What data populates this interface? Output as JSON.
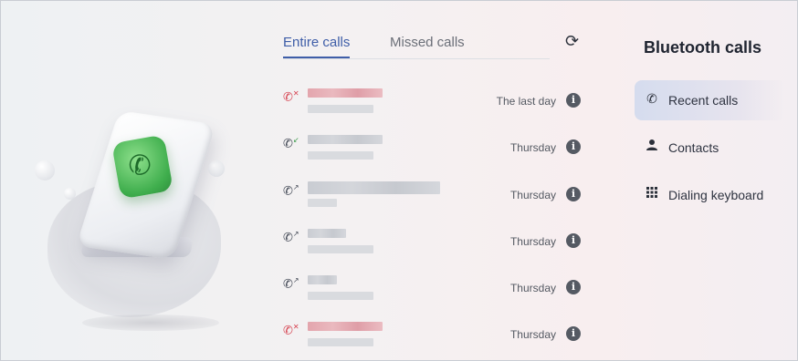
{
  "tabs": {
    "entire": "Entire calls",
    "missed": "Missed calls"
  },
  "refresh_icon": "refresh-icon",
  "calls": [
    {
      "status": "missed",
      "time": "The last day"
    },
    {
      "status": "outgoing",
      "time": "Thursday"
    },
    {
      "status": "incoming",
      "time": "Thursday"
    },
    {
      "status": "incoming",
      "time": "Thursday"
    },
    {
      "status": "incoming",
      "time": "Thursday"
    },
    {
      "status": "missed",
      "time": "Thursday"
    }
  ],
  "info_glyph": "i",
  "panel": {
    "title": "Bluetooth calls",
    "items": [
      {
        "label": "Recent calls",
        "icon": "recent-calls-icon"
      },
      {
        "label": "Contacts",
        "icon": "person-icon"
      },
      {
        "label": "Dialing keyboard",
        "icon": "keypad-icon"
      }
    ]
  },
  "colors": {
    "accent": "#3f5ea8",
    "missed": "#d6404e",
    "phone_green": "#3fae4d"
  }
}
